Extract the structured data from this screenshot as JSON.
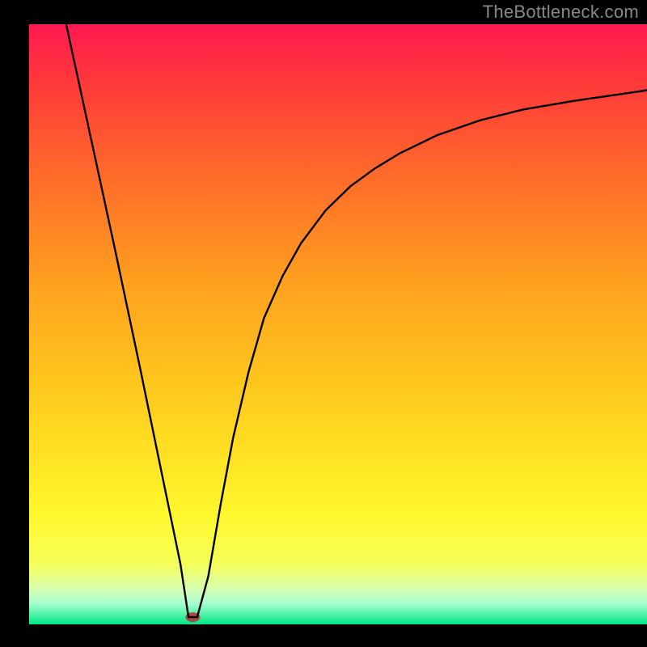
{
  "meta": {
    "attribution": "TheBottleneck.com"
  },
  "chart_data": {
    "type": "line",
    "title": "",
    "xlabel": "",
    "ylabel": "",
    "xlim": [
      0,
      100
    ],
    "ylim": [
      0,
      100
    ],
    "background_gradient": {
      "stops": [
        {
          "offset": 0.0,
          "color": "#ff1a52"
        },
        {
          "offset": 0.1,
          "color": "#ff3a3a"
        },
        {
          "offset": 0.25,
          "color": "#ff6a2a"
        },
        {
          "offset": 0.45,
          "color": "#ffa51e"
        },
        {
          "offset": 0.65,
          "color": "#ffd21e"
        },
        {
          "offset": 0.82,
          "color": "#fff82e"
        },
        {
          "offset": 0.9,
          "color": "#f5ff5a"
        },
        {
          "offset": 0.94,
          "color": "#d8ffb0"
        },
        {
          "offset": 0.965,
          "color": "#a8ffd0"
        },
        {
          "offset": 1.0,
          "color": "#00e884"
        }
      ]
    },
    "marker": {
      "x": 26.5,
      "y": 1.2,
      "color": "#aa4a44"
    },
    "series": [
      {
        "name": "curve",
        "x": [
          6.0,
          10.0,
          14.0,
          18.0,
          22.0,
          24.5,
          25.8,
          27.2,
          29.0,
          31.0,
          33.0,
          35.5,
          38.0,
          41.0,
          44.0,
          48.0,
          52.0,
          56.0,
          60.0,
          66.0,
          73.0,
          80.0,
          88.0,
          100.0
        ],
        "y": [
          100.0,
          81.0,
          62.0,
          42.5,
          22.5,
          10.0,
          1.2,
          1.2,
          8.0,
          20.0,
          31.0,
          42.0,
          51.0,
          58.0,
          63.5,
          69.0,
          73.0,
          76.0,
          78.5,
          81.5,
          84.0,
          85.8,
          87.2,
          89.0
        ]
      }
    ]
  }
}
